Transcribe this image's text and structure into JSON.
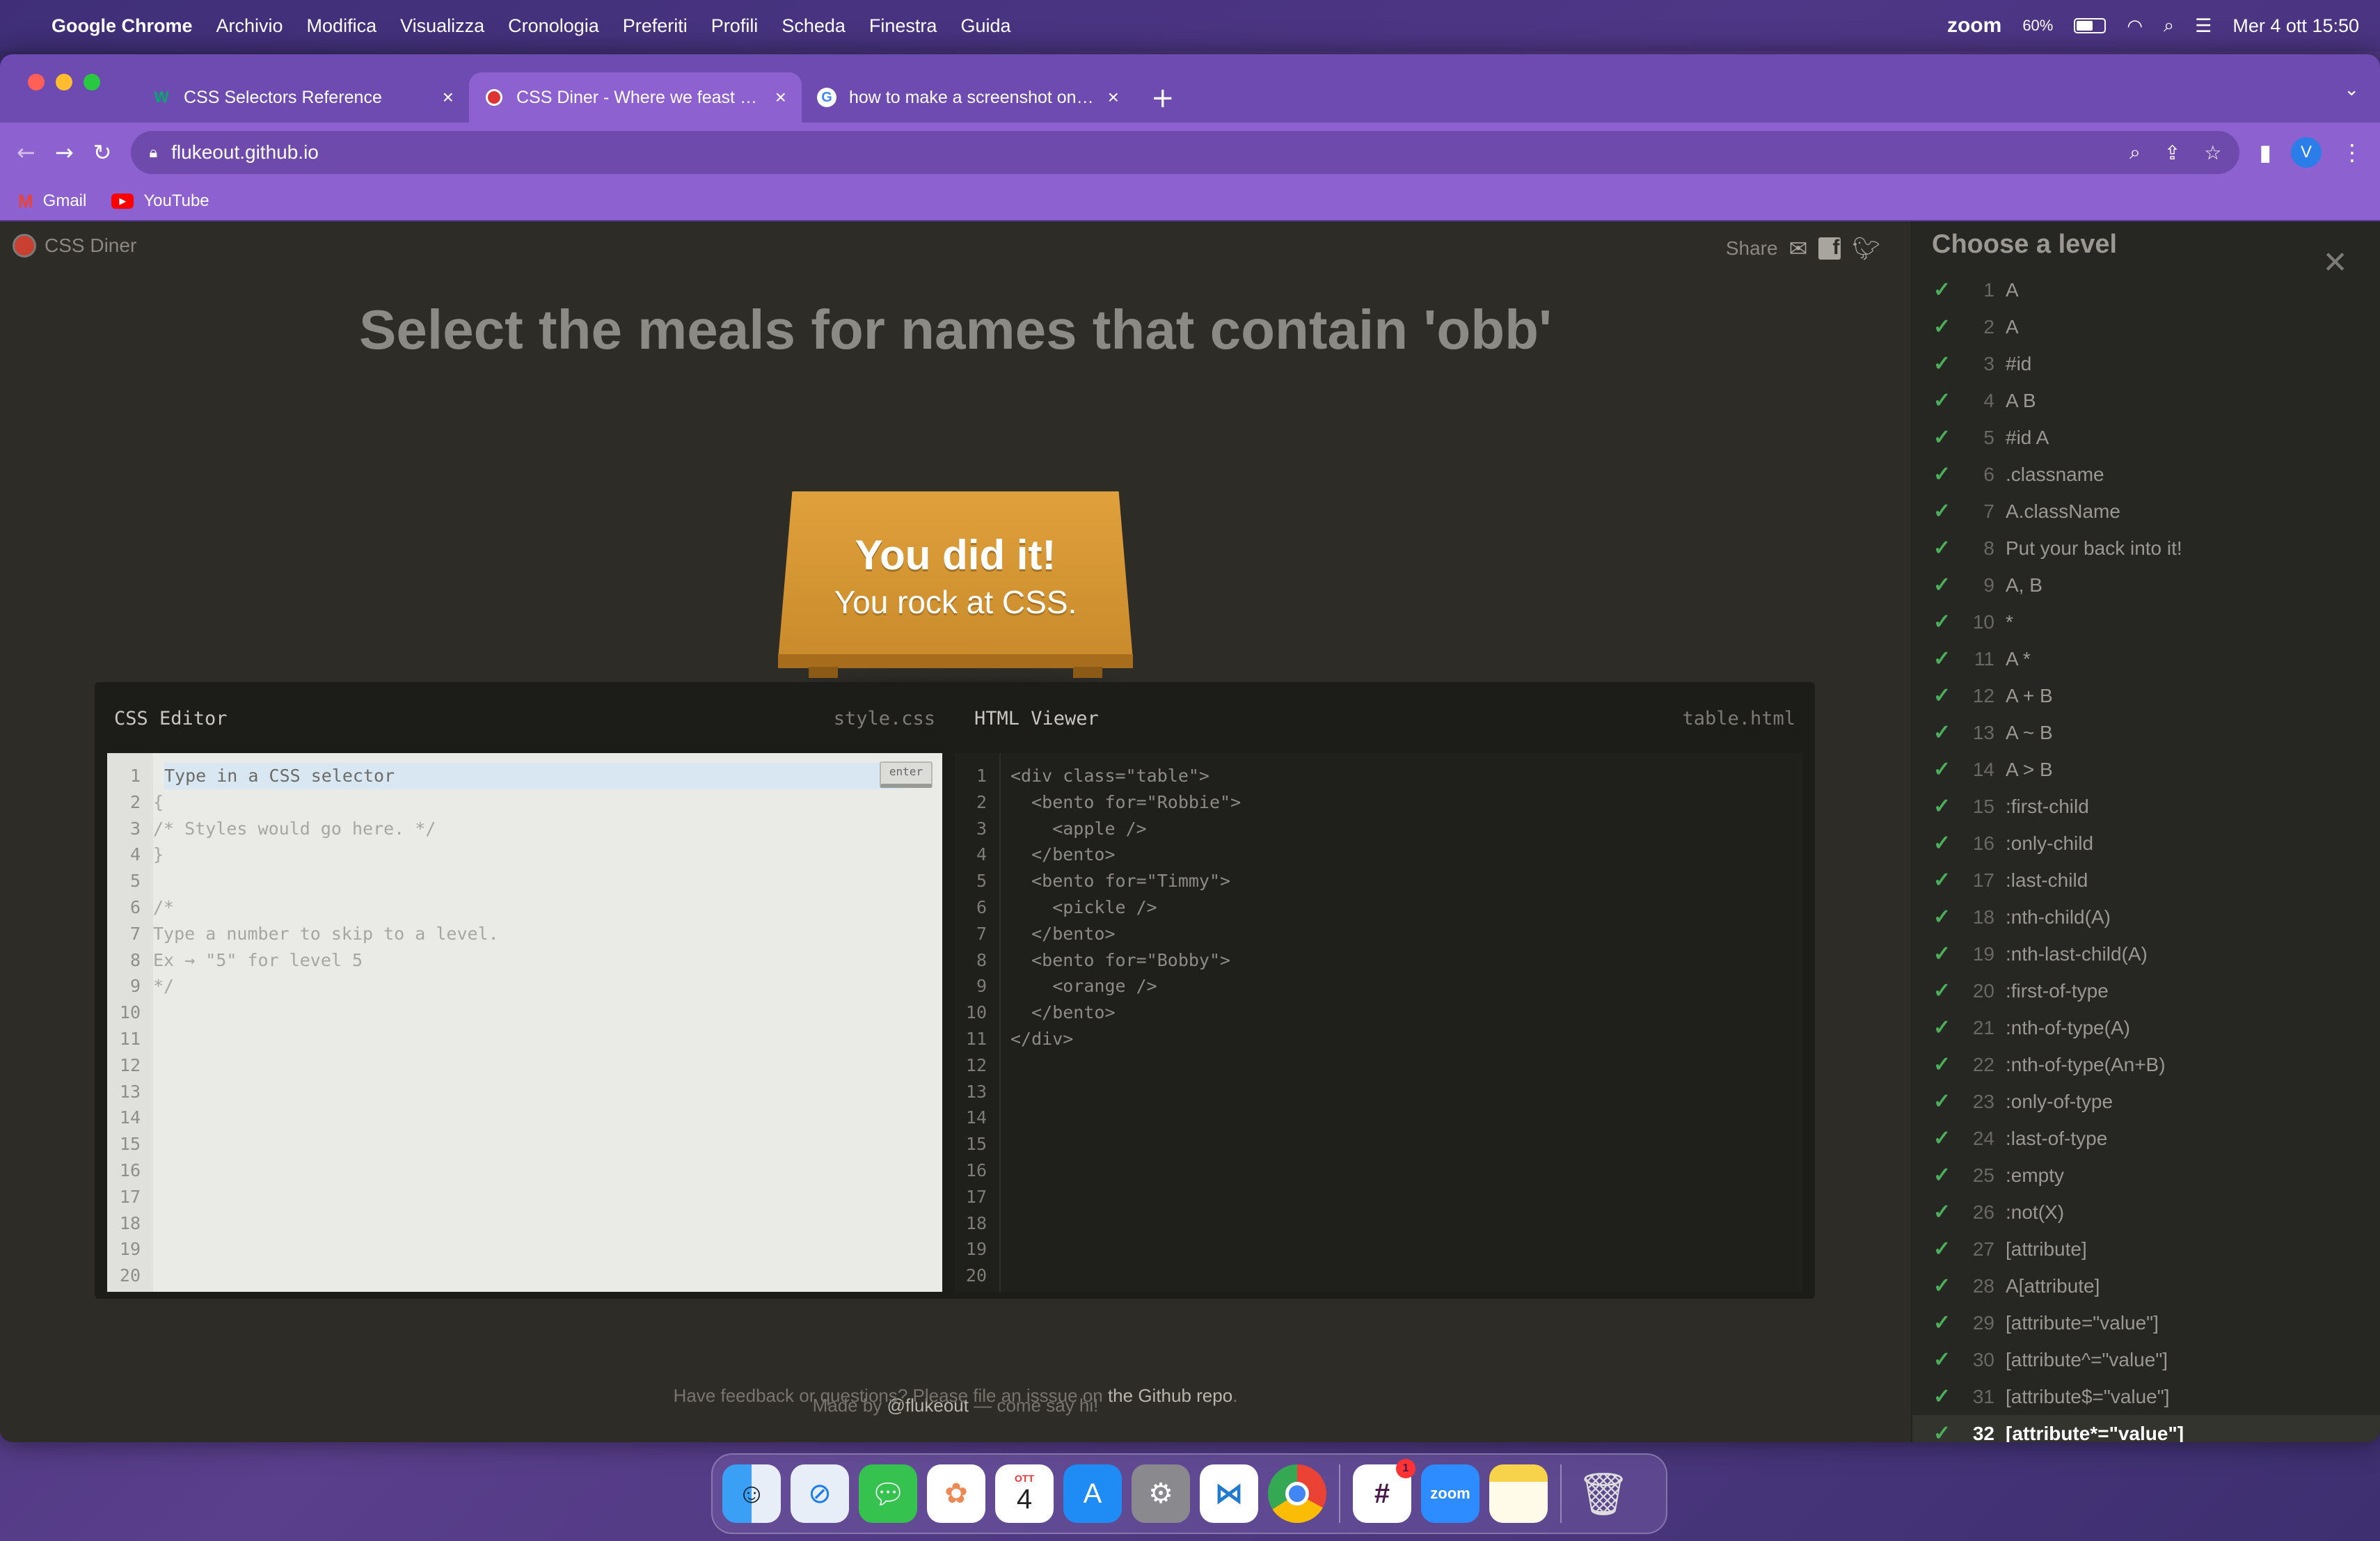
{
  "menubar": {
    "apple": "",
    "items": [
      "Google Chrome",
      "Archivio",
      "Modifica",
      "Visualizza",
      "Cronologia",
      "Preferiti",
      "Profili",
      "Scheda",
      "Finestra",
      "Guida"
    ],
    "zoom": "zoom",
    "battery_text": "60%",
    "battery_level": 0.6,
    "datetime": "Mer 4 ott  15:50"
  },
  "browser": {
    "tabs": [
      {
        "title": "CSS Selectors Reference",
        "icon": "w3-icon"
      },
      {
        "title": "CSS Diner - Where we feast on CSS",
        "icon": "css-diner-icon"
      },
      {
        "title": "how to make a screenshot on mac",
        "icon": "google-icon"
      }
    ],
    "new_tab": "+",
    "url": "flukeout.github.io",
    "bookmarks": [
      {
        "label": "Gmail",
        "icon": "gmail-icon"
      },
      {
        "label": "YouTube",
        "icon": "youtube-icon"
      }
    ],
    "avatar_letter": "V"
  },
  "page": {
    "logo": "CSS Diner",
    "share": "Share",
    "instruction": "Select the meals for names that contain 'obb'",
    "win_line1": "You did it!",
    "win_line2": "You rock at CSS.",
    "css_editor": {
      "title": "CSS Editor",
      "file": "style.css",
      "placeholder": "Type in a CSS selector",
      "enter": "enter",
      "lines": [
        "",
        "{",
        "/* Styles would go here. */",
        "}",
        "",
        "/*",
        "Type a number to skip to a level.",
        "Ex → \"5\" for level 5",
        "*/",
        "",
        "",
        "",
        "",
        "",
        "",
        "",
        "",
        "",
        "",
        ""
      ]
    },
    "html_viewer": {
      "title": "HTML Viewer",
      "file": "table.html",
      "lines": [
        "<div class=\"table\">",
        "  <bento for=\"Robbie\">",
        "    <apple />",
        "  </bento>",
        "  <bento for=\"Timmy\">",
        "    <pickle />",
        "  </bento>",
        "  <bento for=\"Bobby\">",
        "    <orange />",
        "  </bento>",
        "</div>",
        "",
        "",
        "",
        "",
        "",
        "",
        "",
        "",
        ""
      ]
    },
    "footer_made_by": "Made by ",
    "footer_handle": "@flukeout",
    "footer_made_by_tail": " — come say hi!",
    "footer_feedback": "Have feedback or questions? Please file an isssue on ",
    "footer_repo": "the Github repo",
    "footer_feedback_tail": "."
  },
  "levels": {
    "heading": "Choose a level",
    "current": 32,
    "items": [
      "A",
      "A",
      "#id",
      "A B",
      "#id A",
      ".classname",
      "A.className",
      "Put your back into it!",
      "A, B",
      "*",
      "A *",
      "A + B",
      "A ~ B",
      "A > B",
      ":first-child",
      ":only-child",
      ":last-child",
      ":nth-child(A)",
      ":nth-last-child(A)",
      ":first-of-type",
      ":nth-of-type(A)",
      ":nth-of-type(An+B)",
      ":only-of-type",
      ":last-of-type",
      ":empty",
      ":not(X)",
      "[attribute]",
      "A[attribute]",
      "[attribute=\"value\"]",
      "[attribute^=\"value\"]",
      "[attribute$=\"value\"]",
      "[attribute*=\"value\"]"
    ]
  },
  "dock": {
    "apps": [
      "finder",
      "safari",
      "messages",
      "photos",
      "calendar",
      "app-store",
      "system-settings",
      "vscode",
      "chrome",
      "slack",
      "zoom",
      "notes",
      "trash"
    ],
    "calendar_month": "OTT",
    "calendar_day": "4",
    "zoom_label": "zoom",
    "slack_badge": "1"
  }
}
